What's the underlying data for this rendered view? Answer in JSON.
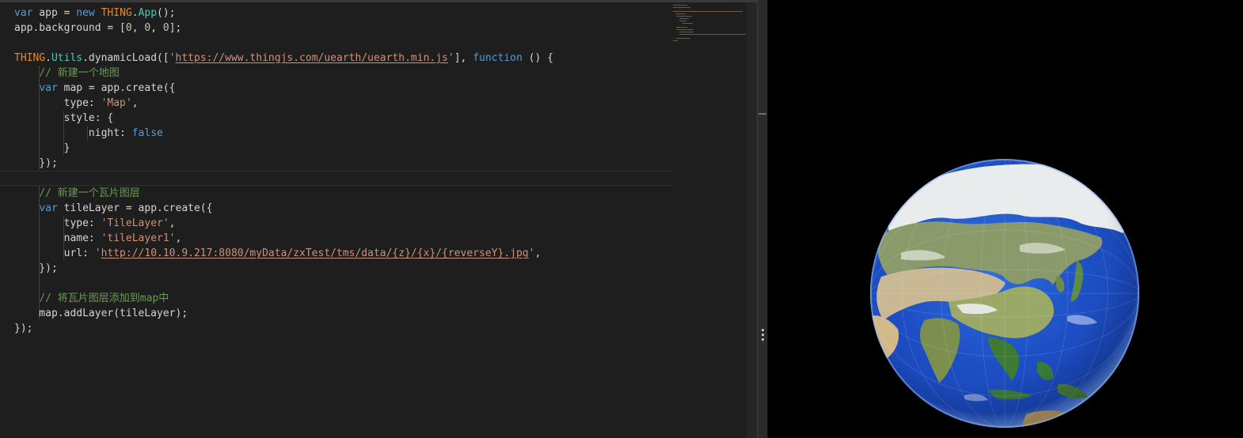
{
  "editor": {
    "lines": [
      {
        "tokens": [
          {
            "t": "var",
            "c": "kw"
          },
          {
            "t": " app = ",
            "c": "fn"
          },
          {
            "t": "new",
            "c": "kw"
          },
          {
            "t": " ",
            "c": "fn"
          },
          {
            "t": "THING",
            "c": "thing"
          },
          {
            "t": ".",
            "c": "fn"
          },
          {
            "t": "App",
            "c": "type"
          },
          {
            "t": "();",
            "c": "fn"
          }
        ]
      },
      {
        "tokens": [
          {
            "t": "app.background = [",
            "c": "fn"
          },
          {
            "t": "0",
            "c": "num"
          },
          {
            "t": ", ",
            "c": "fn"
          },
          {
            "t": "0",
            "c": "num"
          },
          {
            "t": ", ",
            "c": "fn"
          },
          {
            "t": "0",
            "c": "num"
          },
          {
            "t": "];",
            "c": "fn"
          }
        ]
      },
      {
        "tokens": []
      },
      {
        "tokens": [
          {
            "t": "THING",
            "c": "thing"
          },
          {
            "t": ".",
            "c": "fn"
          },
          {
            "t": "Utils",
            "c": "type"
          },
          {
            "t": ".dynamicLoad([",
            "c": "fn"
          },
          {
            "t": "'",
            "c": "str"
          },
          {
            "t": "https://www.thingjs.com/uearth/uearth.min.js",
            "c": "url"
          },
          {
            "t": "'",
            "c": "str"
          },
          {
            "t": "], ",
            "c": "fn"
          },
          {
            "t": "function",
            "c": "kw"
          },
          {
            "t": " () {",
            "c": "fn"
          }
        ]
      },
      {
        "tokens": [
          {
            "t": "    ",
            "c": "fn"
          },
          {
            "t": "// 新建一个地图",
            "c": "cmt"
          }
        ]
      },
      {
        "tokens": [
          {
            "t": "    ",
            "c": "fn"
          },
          {
            "t": "var",
            "c": "kw"
          },
          {
            "t": " map = app.create({",
            "c": "fn"
          }
        ]
      },
      {
        "tokens": [
          {
            "t": "        type: ",
            "c": "fn"
          },
          {
            "t": "'Map'",
            "c": "str"
          },
          {
            "t": ",",
            "c": "fn"
          }
        ]
      },
      {
        "tokens": [
          {
            "t": "        style: {",
            "c": "fn"
          }
        ]
      },
      {
        "tokens": [
          {
            "t": "            night: ",
            "c": "fn"
          },
          {
            "t": "false",
            "c": "bool"
          }
        ]
      },
      {
        "tokens": [
          {
            "t": "        }",
            "c": "fn"
          }
        ]
      },
      {
        "tokens": [
          {
            "t": "    });",
            "c": "fn"
          }
        ]
      },
      {
        "tokens": [],
        "current": true
      },
      {
        "tokens": [
          {
            "t": "    ",
            "c": "fn"
          },
          {
            "t": "// 新建一个瓦片图层",
            "c": "cmt"
          }
        ]
      },
      {
        "tokens": [
          {
            "t": "    ",
            "c": "fn"
          },
          {
            "t": "var",
            "c": "kw"
          },
          {
            "t": " tileLayer = app.create({",
            "c": "fn"
          }
        ]
      },
      {
        "tokens": [
          {
            "t": "        type: ",
            "c": "fn"
          },
          {
            "t": "'TileLayer'",
            "c": "str"
          },
          {
            "t": ",",
            "c": "fn"
          }
        ]
      },
      {
        "tokens": [
          {
            "t": "        name: ",
            "c": "fn"
          },
          {
            "t": "'tileLayer1'",
            "c": "str"
          },
          {
            "t": ",",
            "c": "fn"
          }
        ]
      },
      {
        "tokens": [
          {
            "t": "        url: ",
            "c": "fn"
          },
          {
            "t": "'",
            "c": "str"
          },
          {
            "t": "http://10.10.9.217:8080/myData/zxTest/tms/data/{z}/{x}/{reverseY}.jpg",
            "c": "url"
          },
          {
            "t": "'",
            "c": "str"
          },
          {
            "t": ",",
            "c": "fn"
          }
        ]
      },
      {
        "tokens": [
          {
            "t": "    });",
            "c": "fn"
          }
        ]
      },
      {
        "tokens": []
      },
      {
        "tokens": [
          {
            "t": "    ",
            "c": "fn"
          },
          {
            "t": "// 将瓦片图层添加到map中",
            "c": "cmt"
          }
        ]
      },
      {
        "tokens": [
          {
            "t": "    map.addLayer(tileLayer);",
            "c": "fn"
          }
        ]
      },
      {
        "tokens": [
          {
            "t": "});",
            "c": "fn"
          }
        ]
      }
    ]
  },
  "colors": {
    "editor_bg": "#1e1e1e",
    "keyword": "#569cd6",
    "thing": "#f0841e",
    "type": "#4ec9b0",
    "string": "#ce9178",
    "number": "#b5cea8",
    "comment": "#6a9955",
    "preview_bg": "#000000"
  },
  "preview": {
    "globe": "earth-globe-asia-view"
  }
}
